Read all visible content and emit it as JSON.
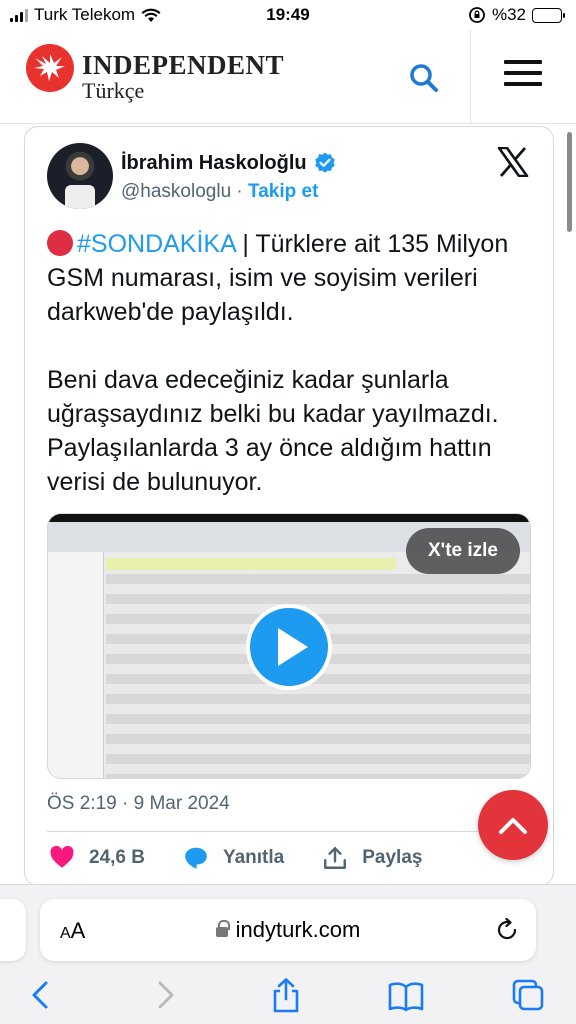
{
  "status_bar": {
    "carrier": "Turk Telekom",
    "time": "19:49",
    "battery": "%32",
    "battery_level": 0.32
  },
  "site": {
    "brand": "INDEPENDENT",
    "subbrand": "Türkçe",
    "icons": [
      "eagle-logo-icon",
      "search-icon",
      "hamburger-menu-icon"
    ],
    "brand_color": "#e8322e"
  },
  "tweet": {
    "author_name": "İbrahim Haskoloğlu",
    "author_handle": "@haskologlu",
    "separator": "·",
    "follow_label": "Takip et",
    "hashtag": "#SONDAKİKA",
    "text_line1_rest": " | Türklere ait 135 Milyon GSM numarası, isim ve soyisim verileri darkweb'de paylaşıldı.",
    "text_para2": "Beni dava edeceğiniz kadar şunlarla uğraşsaydınız belki bu kadar yayılmazdı. Paylaşılanlarda 3 ay önce aldığım hattın verisi de bulunuyor.",
    "watch_label": "X'te izle",
    "timestamp": "ÖS 2:19 · 9 Mar 2024",
    "likes": "24,6 B",
    "reply_label": "Yanıtla",
    "share_label": "Paylaş",
    "accent_color": "#1d9bf0",
    "like_color": "#f91880"
  },
  "browser": {
    "aa_label_big": "A",
    "aa_label_small": "A",
    "url": "indyturk.com",
    "nav_icons": [
      "back-icon",
      "forward-icon",
      "share-icon",
      "bookmarks-icon",
      "tabs-icon"
    ]
  }
}
